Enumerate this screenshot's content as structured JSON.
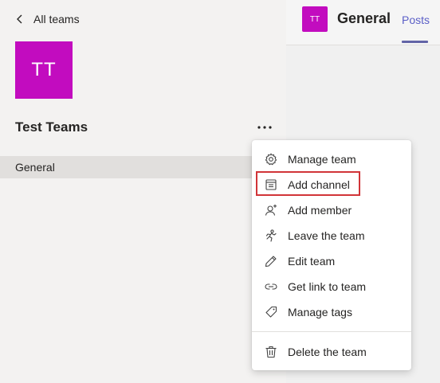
{
  "sidebar": {
    "back_label": "All teams",
    "team_initials": "TT",
    "team_name": "Test Teams",
    "more_options": "•••",
    "channels": [
      {
        "label": "General",
        "selected": true
      }
    ]
  },
  "channel_header": {
    "avatar_initials": "TT",
    "title": "General",
    "tabs": [
      {
        "label": "Posts",
        "active": true
      }
    ]
  },
  "context_menu": {
    "items": [
      {
        "label": "Manage team",
        "icon": "gear-icon"
      },
      {
        "label": "Add channel",
        "icon": "add-channel-icon",
        "highlighted": true
      },
      {
        "label": "Add member",
        "icon": "add-member-icon"
      },
      {
        "label": "Leave the team",
        "icon": "leave-team-icon"
      },
      {
        "label": "Edit team",
        "icon": "pencil-icon"
      },
      {
        "label": "Get link to team",
        "icon": "link-icon"
      },
      {
        "label": "Manage tags",
        "icon": "tag-icon"
      },
      {
        "label": "Delete the team",
        "icon": "trash-icon"
      }
    ]
  },
  "colors": {
    "team_avatar": "#c20cbf",
    "accent": "#6264a7",
    "highlight": "#d13438"
  }
}
